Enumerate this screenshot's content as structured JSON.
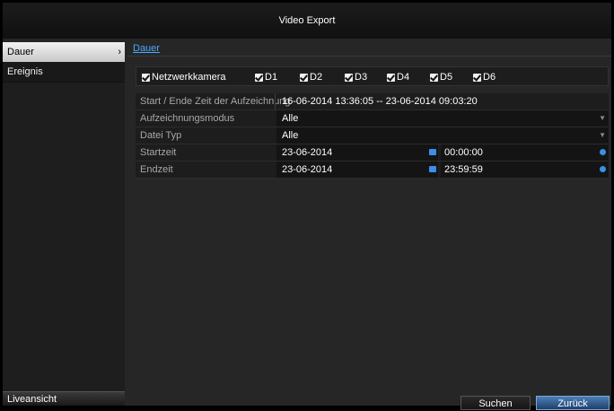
{
  "window": {
    "title": "Video Export"
  },
  "sidebar": {
    "items": [
      {
        "label": "Dauer",
        "active": true
      },
      {
        "label": "Ereignis",
        "active": false
      }
    ],
    "live_view_label": "Liveansicht"
  },
  "tabs": {
    "active_label": "Dauer"
  },
  "cameras": {
    "master": {
      "label": "Netzwerkkamera",
      "checked": true
    },
    "channels": [
      {
        "label": "D1",
        "checked": true
      },
      {
        "label": "D2",
        "checked": true
      },
      {
        "label": "D3",
        "checked": true
      },
      {
        "label": "D4",
        "checked": true
      },
      {
        "label": "D5",
        "checked": true
      },
      {
        "label": "D6",
        "checked": true
      }
    ]
  },
  "form": {
    "range": {
      "label": "Start / Ende Zeit der Aufzeichnung",
      "value": "16-06-2014 13:36:05 -- 23-06-2014 09:03:20"
    },
    "record_mode": {
      "label": "Aufzeichnungsmodus",
      "value": "Alle"
    },
    "file_type": {
      "label": "Datei Typ",
      "value": "Alle"
    },
    "start": {
      "label": "Startzeit",
      "date": "23-06-2014",
      "time": "00:00:00"
    },
    "end": {
      "label": "Endzeit",
      "date": "23-06-2014",
      "time": "23:59:59"
    }
  },
  "buttons": {
    "search": "Suchen",
    "back": "Zurück"
  },
  "colors": {
    "accent": "#4aa8ff",
    "primary_button": "#3a6aa3",
    "icon_blue": "#3b8fe8"
  }
}
